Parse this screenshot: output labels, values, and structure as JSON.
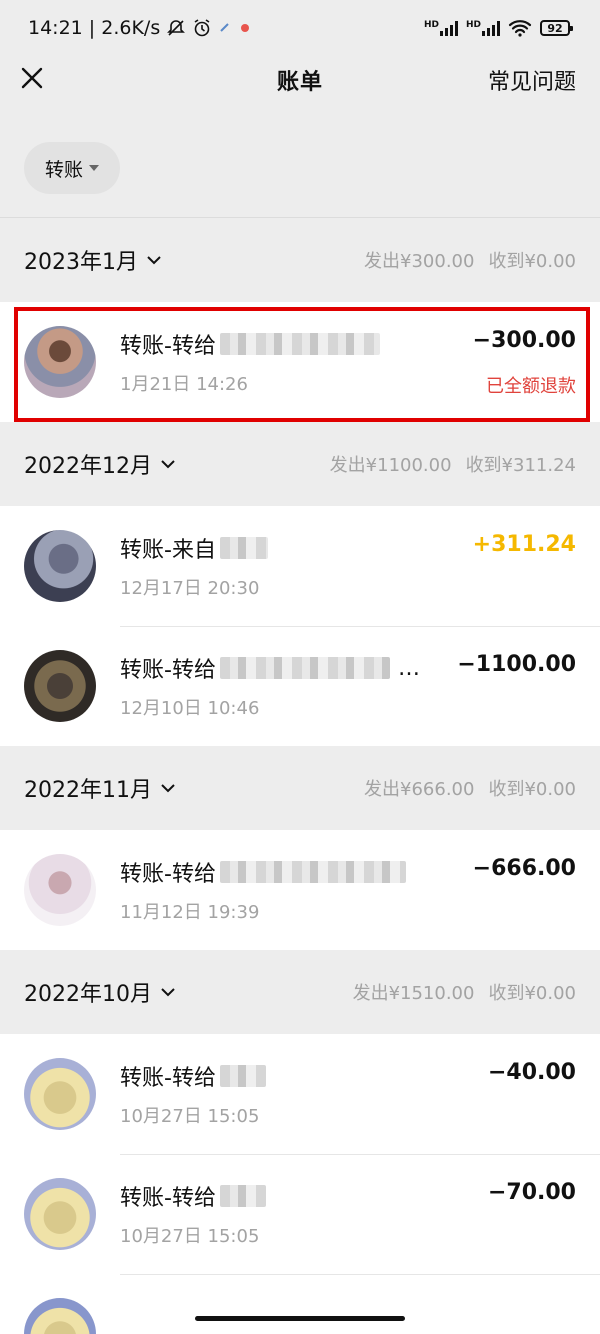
{
  "status_bar": {
    "time_speed": "14:21 | 2.6K/s",
    "hd1": "HD",
    "hd2": "HD",
    "battery": "92"
  },
  "header": {
    "title": "账单",
    "faq": "常见问题"
  },
  "filter": {
    "label": "转账"
  },
  "months": [
    {
      "label": "2023年1月",
      "out": "发出¥300.00",
      "in": "收到¥0.00",
      "items": [
        {
          "title": "转账-转给",
          "date": "1月21日 14:26",
          "amount": "−300.00",
          "status": "已全额退款"
        }
      ]
    },
    {
      "label": "2022年12月",
      "out": "发出¥1100.00",
      "in": "收到¥311.24",
      "items": [
        {
          "title": "转账-来自",
          "date": "12月17日 20:30",
          "amount": "+311.24"
        },
        {
          "title": "转账-转给",
          "date": "12月10日 10:46",
          "amount": "−1100.00",
          "ellipsis": "…"
        }
      ]
    },
    {
      "label": "2022年11月",
      "out": "发出¥666.00",
      "in": "收到¥0.00",
      "items": [
        {
          "title": "转账-转给",
          "date": "11月12日 19:39",
          "amount": "−666.00"
        }
      ]
    },
    {
      "label": "2022年10月",
      "out": "发出¥1510.00",
      "in": "收到¥0.00",
      "items": [
        {
          "title": "转账-转给",
          "date": "10月27日 15:05",
          "amount": "−40.00"
        },
        {
          "title": "转账-转给",
          "date": "10月27日 15:05",
          "amount": "−70.00"
        }
      ]
    }
  ],
  "colors": {
    "refund_red": "#e0433c",
    "income_yellow": "#f5b800",
    "highlight_red": "#e00000"
  }
}
